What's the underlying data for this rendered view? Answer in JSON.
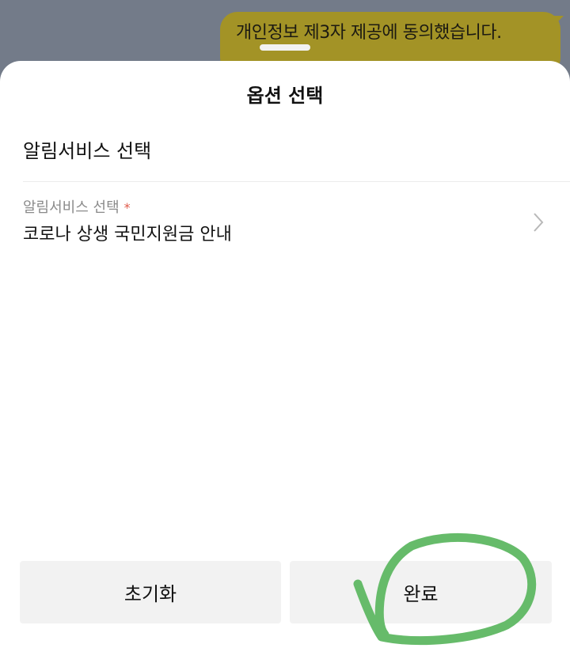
{
  "chat": {
    "bubble_text": "개인정보 제3자 제공에 동의했습니다."
  },
  "sheet": {
    "title": "옵션 선택",
    "section_title": "알림서비스 선택",
    "field": {
      "label": "알림서비스 선택",
      "required_mark": "*",
      "value": "코로나 상생 국민지원금 안내"
    },
    "buttons": {
      "reset_label": "초기화",
      "done_label": "완료"
    }
  },
  "colors": {
    "bubble": "#a39326",
    "annotation_circle": "#66bb6a",
    "required_mark": "#e05a4a"
  },
  "icons": {
    "row_chevron": "chevron-right-icon"
  },
  "annotation": {
    "type": "hand-drawn-circle",
    "target": "done-button"
  }
}
